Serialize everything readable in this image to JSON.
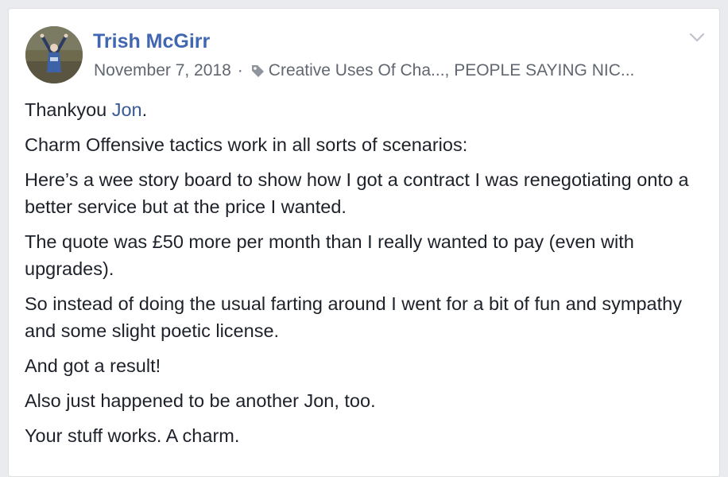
{
  "post": {
    "author": "Trish McGirr",
    "date": "November 7, 2018",
    "separator": "·",
    "tags_text": "Creative Uses Of Cha..., PEOPLE SAYING NIC...",
    "icons": {
      "avatar": "profile-photo",
      "tag": "tag-icon",
      "menu": "chevron-down-icon"
    },
    "colors": {
      "author": "#4267b2",
      "mention": "#385898",
      "meta": "#616770",
      "text": "#1d2129"
    },
    "paragraphs": {
      "p1_before": "Thankyou ",
      "p1_mention": "Jon",
      "p1_after": ".",
      "p2": "Charm Offensive tactics work in all sorts of scenarios:",
      "p3": "Here’s a wee story board to show how I got a contract I was renegotiating onto a better service but at the price I wanted.",
      "p4": "The quote was £50 more per month than I really wanted to pay (even with upgrades).",
      "p5": "So instead of doing the usual farting around I went for a bit of fun and sympathy and some slight poetic license.",
      "p6": "And got a result!",
      "p7": "Also just happened to be another Jon, too.",
      "p8": "Your stuff works. A charm."
    }
  }
}
